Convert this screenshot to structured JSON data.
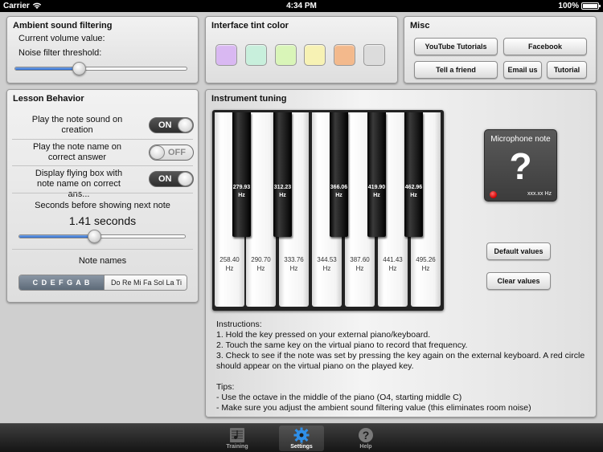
{
  "status_bar": {
    "carrier": "Carrier",
    "time": "4:34 PM",
    "battery": "100%"
  },
  "ambient": {
    "title": "Ambient sound filtering",
    "volume_label": "Current volume value:",
    "noise_label": "Noise filter threshold:",
    "noise_level_fraction": 0.37
  },
  "tint": {
    "title": "Interface tint color",
    "swatches": [
      "#d9b8f2",
      "#c8efdc",
      "#d9f5b8",
      "#f7f2b4",
      "#f3b98c",
      "#dcdcdc"
    ]
  },
  "misc": {
    "title": "Misc",
    "youtube": "YouTube Tutorials",
    "facebook": "Facebook",
    "tell_friend": "Tell a friend",
    "email": "Email us",
    "tutorial": "Tutorial"
  },
  "lesson": {
    "title": "Lesson Behavior",
    "play_sound": "Play the note sound on creation",
    "play_sound_state": "ON",
    "play_name": "Play the note name on correct answer",
    "play_name_state": "OFF",
    "flying_box": "Display flying box with note name on correct ans...",
    "flying_box_state": "ON",
    "seconds_label": "Seconds before showing next note",
    "seconds_value": "1.41 seconds",
    "seconds_fraction": 0.45,
    "note_names_label": "Note names",
    "note_names_options": [
      "C D E F G A B",
      "Do Re Mi Fa Sol La Ti"
    ],
    "note_names_selected": 0
  },
  "instrument": {
    "title": "Instrument tuning",
    "white_keys": [
      {
        "freq": "258.40",
        "unit": "Hz"
      },
      {
        "freq": "290.70",
        "unit": "Hz"
      },
      {
        "freq": "333.76",
        "unit": "Hz"
      },
      {
        "freq": "344.53",
        "unit": "Hz"
      },
      {
        "freq": "387.60",
        "unit": "Hz"
      },
      {
        "freq": "441.43",
        "unit": "Hz"
      },
      {
        "freq": "495.26",
        "unit": "Hz"
      }
    ],
    "black_keys": [
      {
        "freq": "279.93",
        "unit": "Hz"
      },
      {
        "freq": "312.23",
        "unit": "Hz"
      },
      {
        "freq": "366.06",
        "unit": "Hz"
      },
      {
        "freq": "419.90",
        "unit": "Hz"
      },
      {
        "freq": "462.96",
        "unit": "Hz"
      }
    ],
    "mic_title": "Microphone note",
    "mic_note": "?",
    "mic_hz": "xxx.xx Hz",
    "default_button": "Default values",
    "clear_button": "Clear values",
    "instructions_heading": "Instructions:",
    "instructions": [
      "1. Hold the key pressed on your external piano/keyboard.",
      "2. Touch the same key on the virtual piano to record that frequency.",
      "3. Check to see if the note was set by pressing the key again on the external keyboard. A red circle should appear on the virtual piano on the played key."
    ],
    "tips_heading": "Tips:",
    "tips": [
      "- Use the octave in the middle of the piano (O4, starting middle C)",
      "- Make sure you adjust the ambient sound filtering value (this eliminates room noise)"
    ]
  },
  "tabs": [
    {
      "label": "Training",
      "icon": "sheet-music-icon"
    },
    {
      "label": "Settings",
      "icon": "gear-icon"
    },
    {
      "label": "Help",
      "icon": "question-icon"
    }
  ],
  "tabs_selected": 1
}
